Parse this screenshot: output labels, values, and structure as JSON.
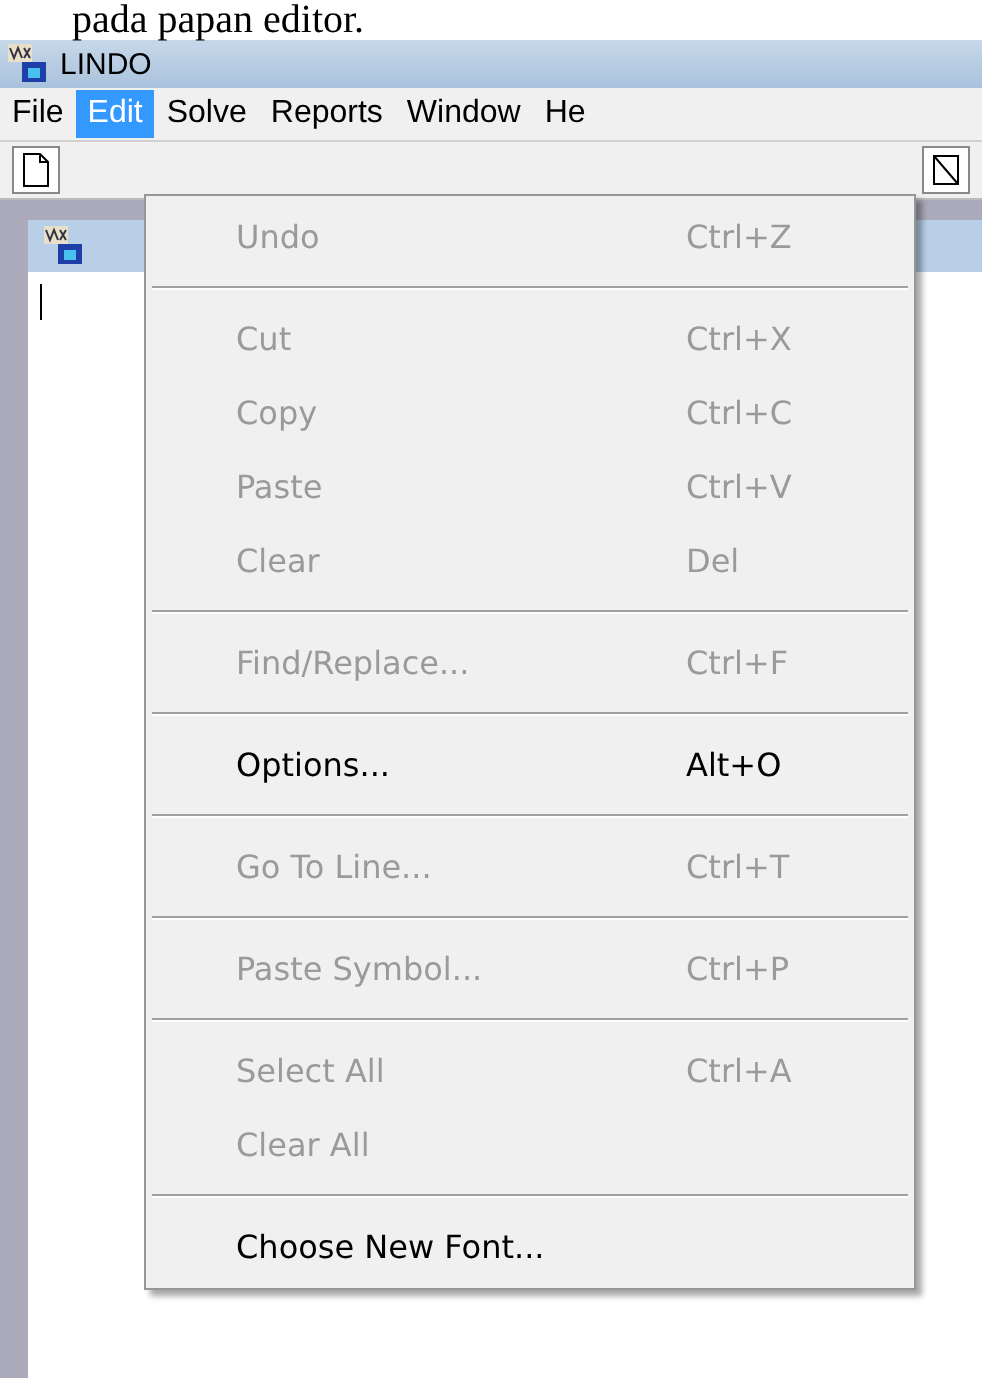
{
  "caption": "pada papan editor.",
  "window": {
    "title": "LINDO"
  },
  "menubar": [
    {
      "label": "File",
      "selected": false
    },
    {
      "label": "Edit",
      "selected": true
    },
    {
      "label": "Solve",
      "selected": false
    },
    {
      "label": "Reports",
      "selected": false
    },
    {
      "label": "Window",
      "selected": false
    },
    {
      "label": "He",
      "selected": false
    }
  ],
  "edit_menu": [
    {
      "kind": "item",
      "label": "Undo",
      "shortcut": "Ctrl+Z",
      "disabled": true
    },
    {
      "kind": "separator"
    },
    {
      "kind": "item",
      "label": "Cut",
      "shortcut": "Ctrl+X",
      "disabled": true
    },
    {
      "kind": "item",
      "label": "Copy",
      "shortcut": "Ctrl+C",
      "disabled": true
    },
    {
      "kind": "item",
      "label": "Paste",
      "shortcut": "Ctrl+V",
      "disabled": true
    },
    {
      "kind": "item",
      "label": "Clear",
      "shortcut": "Del",
      "disabled": true
    },
    {
      "kind": "separator"
    },
    {
      "kind": "item",
      "label": "Find/Replace...",
      "shortcut": "Ctrl+F",
      "disabled": true
    },
    {
      "kind": "separator"
    },
    {
      "kind": "item",
      "label": "Options...",
      "shortcut": "Alt+O",
      "disabled": false
    },
    {
      "kind": "separator"
    },
    {
      "kind": "item",
      "label": "Go To Line...",
      "shortcut": "Ctrl+T",
      "disabled": true
    },
    {
      "kind": "separator"
    },
    {
      "kind": "item",
      "label": "Paste Symbol...",
      "shortcut": "Ctrl+P",
      "disabled": true
    },
    {
      "kind": "separator"
    },
    {
      "kind": "item",
      "label": "Select All",
      "shortcut": "Ctrl+A",
      "disabled": true
    },
    {
      "kind": "item",
      "label": "Clear All",
      "disabled": true
    },
    {
      "kind": "separator"
    },
    {
      "kind": "item",
      "label": "Choose New Font...",
      "disabled": false
    }
  ]
}
